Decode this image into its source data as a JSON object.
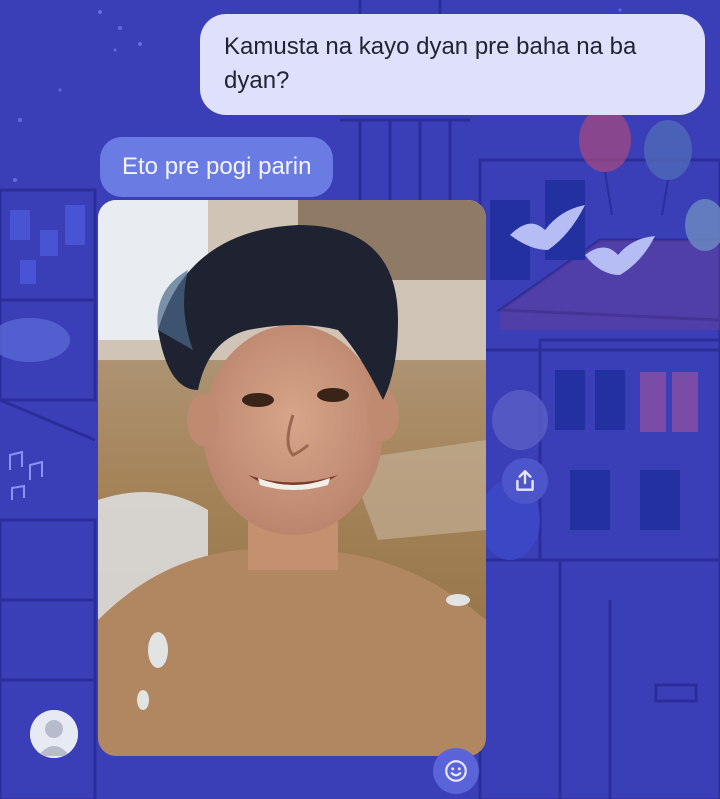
{
  "conversation": {
    "messages": [
      {
        "direction": "outgoing",
        "text": "Kamusta na kayo dyan pre baha na ba dyan?"
      },
      {
        "direction": "incoming",
        "text": "Eto pre pogi parin"
      }
    ],
    "attachment": {
      "type": "photo"
    }
  },
  "icons": {
    "share": "share-icon",
    "reaction": "smiley-icon",
    "avatar": "user-avatar-icon"
  },
  "colors": {
    "background": "#3a3fb8",
    "outgoing_bubble": "#dfe0fb",
    "incoming_bubble": "#6b7be4"
  }
}
